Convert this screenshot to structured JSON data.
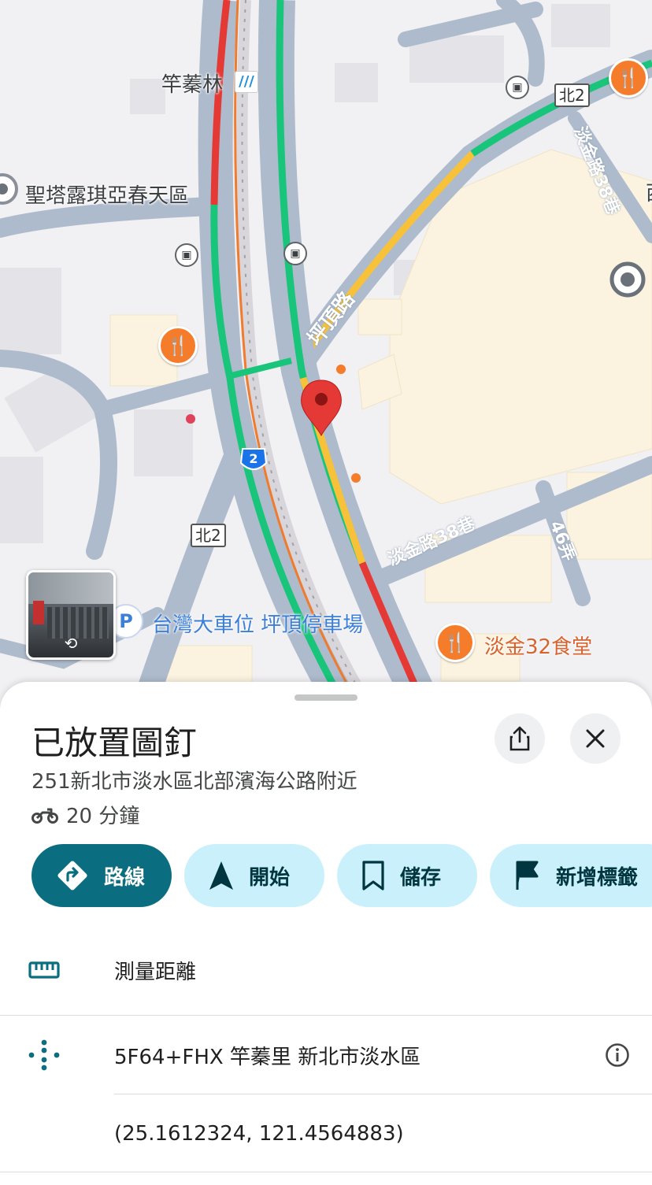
{
  "map": {
    "labels": {
      "station": "竿蓁林",
      "park": "聖塔露琪亞春天區",
      "road_pingding": "坪頂路",
      "lane_38_top": "淡金路38巷",
      "lane_38_bottom": "淡金路38巷",
      "alley_46": "46弄",
      "parking": "台灣大車位 坪頂停車場",
      "restaurant": "淡金32食堂",
      "cut_letter": "西"
    },
    "shields": {
      "north2_top": "北2",
      "north2_bottom": "北2",
      "route2": "2"
    },
    "colors": {
      "traffic_green": "#18c57a",
      "traffic_red": "#e53935",
      "traffic_yellow": "#f7c239",
      "pin": "#e53935"
    }
  },
  "sheet": {
    "title": "已放置圖釘",
    "address": "251新北市淡水區北部濱海公路附近",
    "eta": "20 分鐘",
    "actions": [
      {
        "label": "路線",
        "icon": "directions-icon"
      },
      {
        "label": "開始",
        "icon": "navigate-arrow-icon"
      },
      {
        "label": "儲存",
        "icon": "bookmark-icon"
      },
      {
        "label": "新增標籤",
        "icon": "flag-icon"
      }
    ],
    "measure": "測量距離",
    "plus_code": "5F64+FHX 竿蓁里 新北市淡水區",
    "coordinates": "(25.1612324, 121.4564883)"
  },
  "accent": "#0b6e80"
}
